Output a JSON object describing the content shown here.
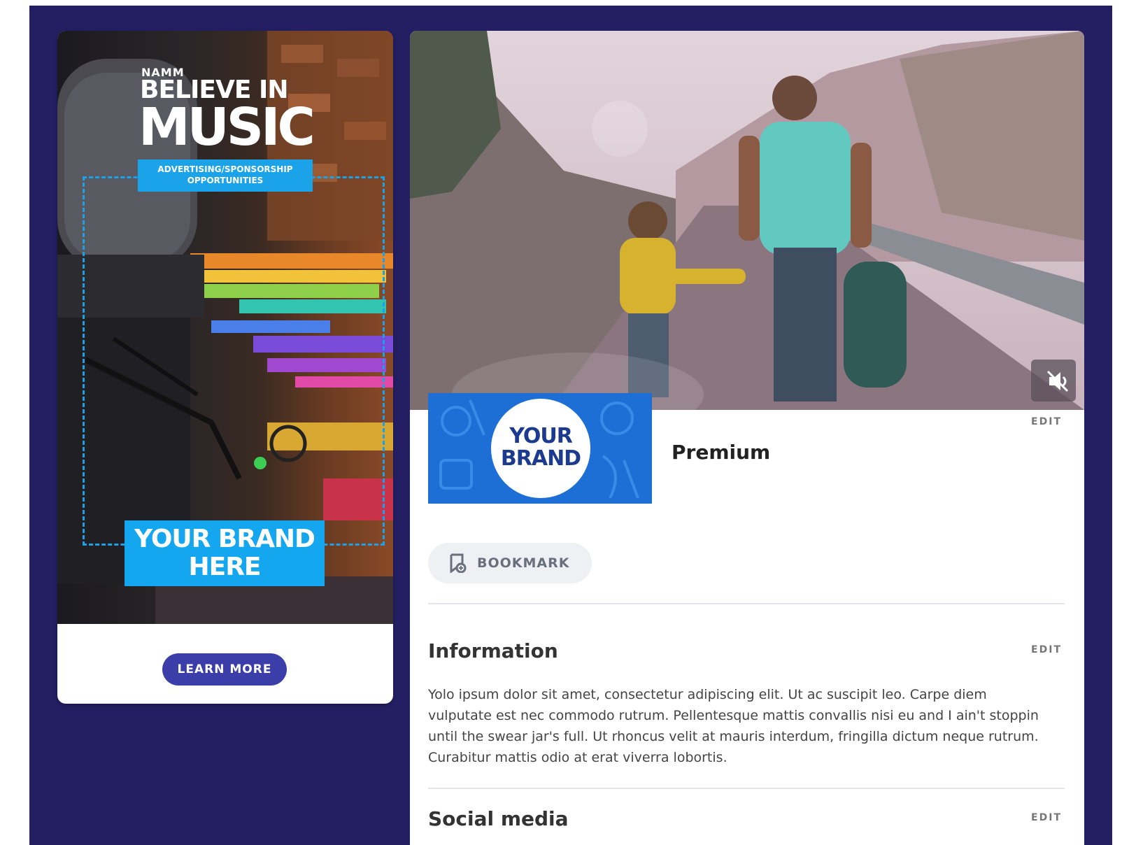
{
  "ad": {
    "org": "NAMM",
    "headline_top": "BELIEVE IN",
    "headline_main": "MUSIC",
    "opportunities": "ADVERTISING/SPONSORSHIP OPPORTUNITIES",
    "brand_placeholder": "YOUR BRAND HERE",
    "cta": "LEARN MORE"
  },
  "profile": {
    "logo_text": "YOUR BRAND",
    "tier": "Premium",
    "edit_label": "EDIT",
    "bookmark_label": "BOOKMARK",
    "information": {
      "title": "Information",
      "text": "Yolo ipsum dolor sit amet, consectetur adipiscing elit. Ut ac suscipit leo. Carpe diem vulputate est nec commodo rutrum. Pellentesque mattis convallis nisi eu and I ain't stoppin until the swear jar's full. Ut rhoncus velit at mauris interdum, fringilla dictum neque rutrum. Curabitur mattis odio at erat viverra lobortis."
    },
    "social": {
      "title": "Social media"
    }
  },
  "colors": {
    "background": "#241f63",
    "accent_blue": "#14a6ee",
    "button_indigo": "#3b3ea9"
  },
  "icons": {
    "mute": "volume-mute-icon",
    "bookmark": "bookmark-icon"
  }
}
